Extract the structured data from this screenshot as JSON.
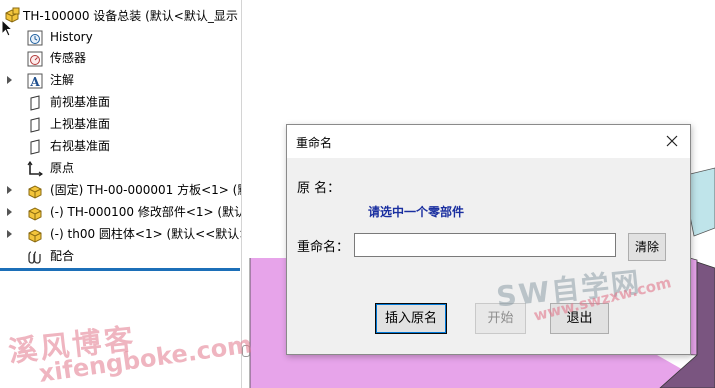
{
  "tree": {
    "root_label": "TH-100000 设备总装  (默认<默认_显示",
    "items": [
      {
        "label": "History",
        "icon": "history-icon",
        "expandable": false
      },
      {
        "label": "传感器",
        "icon": "sensor-icon",
        "expandable": false
      },
      {
        "label": "注解",
        "icon": "annotation-icon",
        "expandable": true
      },
      {
        "label": "前视基准面",
        "icon": "plane-icon",
        "expandable": false
      },
      {
        "label": "上视基准面",
        "icon": "plane-icon",
        "expandable": false
      },
      {
        "label": "右视基准面",
        "icon": "plane-icon",
        "expandable": false
      },
      {
        "label": "原点",
        "icon": "origin-icon",
        "expandable": false
      },
      {
        "label": "(固定) TH-00-000001 方板<1> (默",
        "icon": "part-icon",
        "expandable": true
      },
      {
        "label": "(-) TH-000100 修改部件<1> (默认",
        "icon": "part-icon",
        "expandable": true
      },
      {
        "label": "(-) th00 圆柱体<1> (默认<<默认>",
        "icon": "part-icon",
        "expandable": true
      },
      {
        "label": "配合",
        "icon": "mates-icon",
        "expandable": false
      }
    ]
  },
  "dialog": {
    "title": "重命名",
    "original_name_label": "原   名：",
    "original_name_value": "请选中一个零部件",
    "rename_label": "重命名：",
    "rename_value": "",
    "clear_button": "清除",
    "insert_original_button": "插入原名",
    "start_button": "开始",
    "exit_button": "退出"
  },
  "watermarks": {
    "left_cn": "溪风博客",
    "left_en": "xifengboke.com",
    "right_cn": "SW自学网",
    "right_en": "www.swzxw.com"
  },
  "colors": {
    "selection_line": "#1c6fb8",
    "hint_text": "#1a2fa0",
    "part_pink": "#e7a4ea",
    "part_purple": "#7a5580",
    "part_teal": "#bfe4ea"
  }
}
